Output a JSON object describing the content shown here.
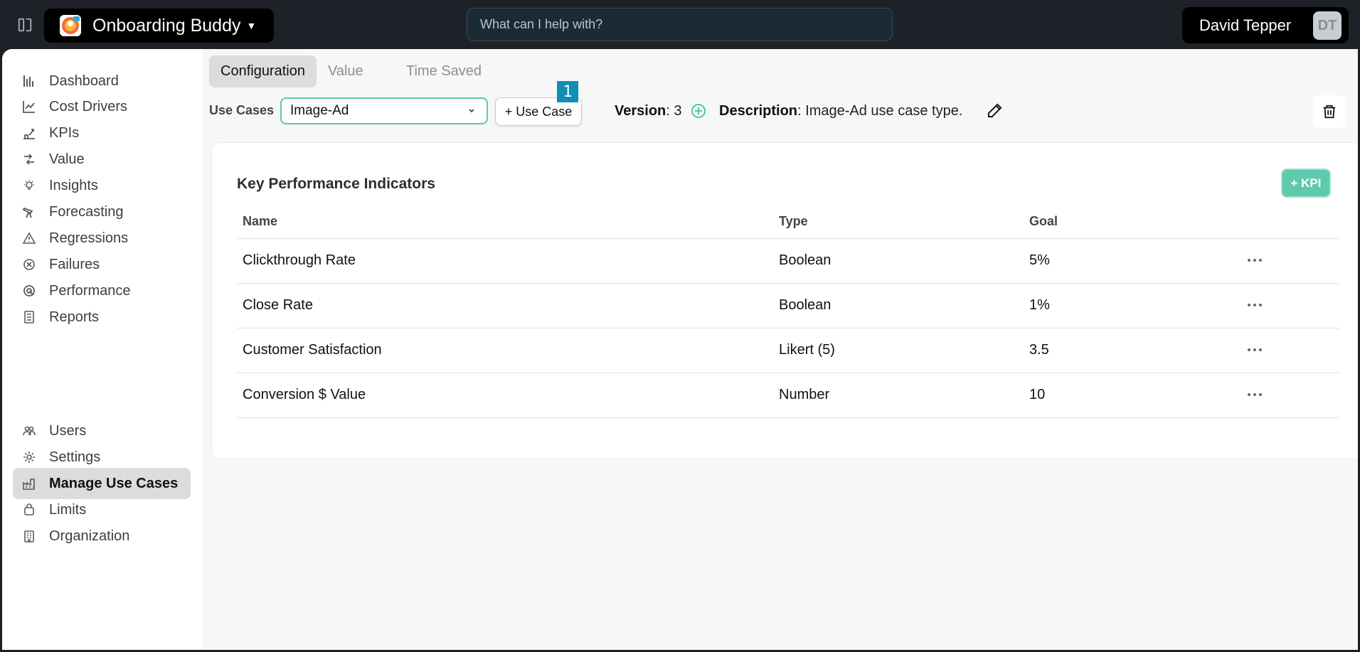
{
  "app": {
    "title": "Onboarding Buddy"
  },
  "search": {
    "placeholder": "What can I help with?"
  },
  "user": {
    "name": "David Tepper",
    "initials": "DT"
  },
  "sidebar": {
    "items": [
      {
        "label": "Dashboard",
        "icon": "bar-chart-icon"
      },
      {
        "label": "Cost Drivers",
        "icon": "line-chart-icon"
      },
      {
        "label": "KPIs",
        "icon": "kpi-icon"
      },
      {
        "label": "Value",
        "icon": "exchange-icon"
      },
      {
        "label": "Insights",
        "icon": "lightbulb-icon"
      },
      {
        "label": "Forecasting",
        "icon": "telescope-icon"
      },
      {
        "label": "Regressions",
        "icon": "warning-icon"
      },
      {
        "label": "Failures",
        "icon": "circle-x-icon"
      },
      {
        "label": "Performance",
        "icon": "gauge-icon"
      },
      {
        "label": "Reports",
        "icon": "document-icon"
      }
    ],
    "bottom_items": [
      {
        "label": "Users",
        "icon": "users-icon"
      },
      {
        "label": "Settings",
        "icon": "gear-icon"
      },
      {
        "label": "Manage Use Cases",
        "icon": "factory-icon",
        "active": true
      },
      {
        "label": "Limits",
        "icon": "limits-icon"
      },
      {
        "label": "Organization",
        "icon": "building-icon"
      }
    ]
  },
  "tabs": [
    {
      "label": "Configuration",
      "active": true
    },
    {
      "label": "Value"
    },
    {
      "label": "Time Saved"
    }
  ],
  "use_case": {
    "label": "Use Cases",
    "selected": "Image-Ad",
    "add_label": "+ Use Case",
    "badge": "1",
    "version_label": "Version",
    "version_value": ": 3",
    "description_label": "Description",
    "description_value": ": Image-Ad use case type."
  },
  "kpi_card": {
    "title": "Key Performance Indicators",
    "add_label": "+ KPI",
    "columns": [
      "Name",
      "Type",
      "Goal"
    ],
    "rows": [
      {
        "name": "Clickthrough Rate",
        "type": "Boolean",
        "goal": "5%"
      },
      {
        "name": "Close Rate",
        "type": "Boolean",
        "goal": "1%"
      },
      {
        "name": "Customer Satisfaction",
        "type": "Likert (5)",
        "goal": "3.5"
      },
      {
        "name": "Conversion $ Value",
        "type": "Number",
        "goal": "10"
      }
    ]
  },
  "colors": {
    "accent": "#5fc9ad",
    "badge": "#0e8fb3",
    "topbar": "#1e2228"
  }
}
